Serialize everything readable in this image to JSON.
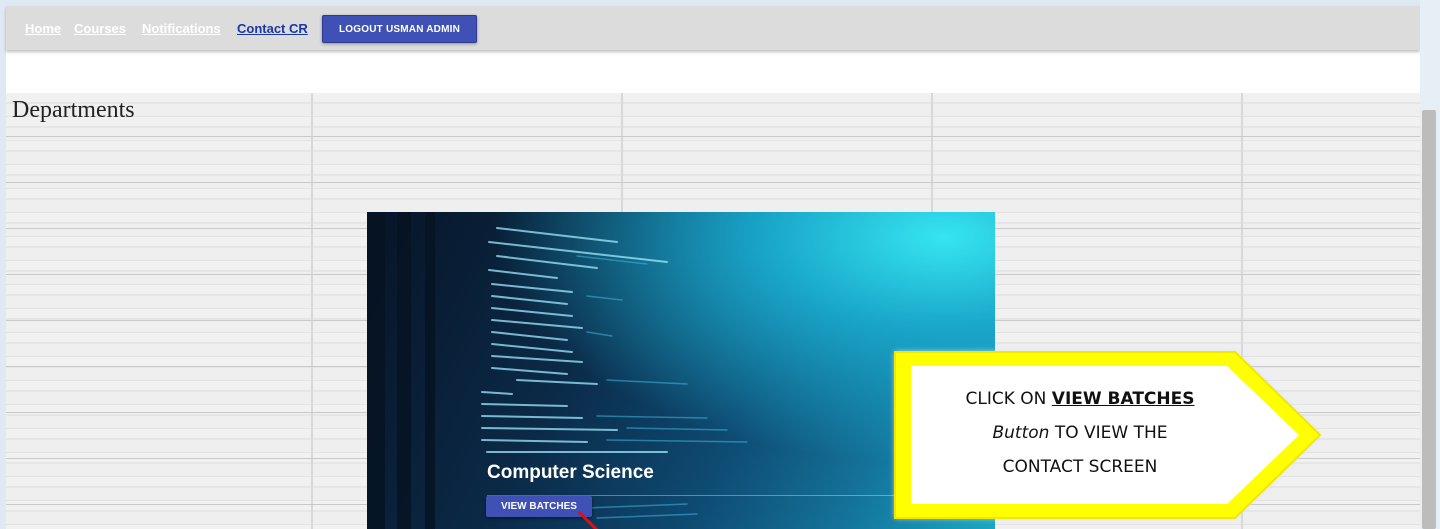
{
  "nav": {
    "home": "Home",
    "courses": "Courses",
    "notifications": "Notifications",
    "contact_cr": "Contact CR",
    "logout": "LOGOUT USMAN ADMIN"
  },
  "page_title": "Departments",
  "card": {
    "title": "Computer Science",
    "button": "VIEW BATCHES"
  },
  "callout": {
    "prefix": "CLICK ON ",
    "emphasis": "VIEW BATCHES",
    "italic": "Button",
    "line2_rest": " TO VIEW THE",
    "line3": "CONTACT SCREEN"
  },
  "colors": {
    "button_blue": "#3f51b5",
    "callout_yellow": "#ffff00"
  }
}
